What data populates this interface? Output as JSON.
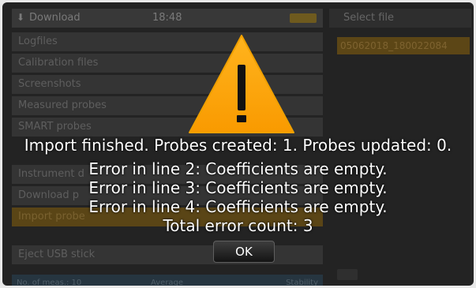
{
  "app": {
    "title": "Download",
    "time": "18:48",
    "badge": "",
    "menu": [
      {
        "label": "Logfiles"
      },
      {
        "label": "Calibration files"
      },
      {
        "label": "Screenshots"
      },
      {
        "label": "Measured probes"
      },
      {
        "label": "SMART probes"
      },
      {
        "label": "Instrument d"
      },
      {
        "label": "Download p"
      },
      {
        "label": "Import probe"
      },
      {
        "label": "Eject USB stick"
      }
    ],
    "status": {
      "left": "No. of meas.: 10",
      "mid": "Average",
      "right": "Stability"
    }
  },
  "file_panel": {
    "title": "Select file",
    "selected_file": "05062018_180022084"
  },
  "dialog": {
    "icon": "warning-icon",
    "icon_color": "#ffa500",
    "lines": [
      "Import finished. Probes created: 1. Probes updated: 0.",
      "Error in line 2: Coefficients are empty.",
      "Error in line 3: Coefficients are empty.",
      "Error in line 4: Coefficients are empty.",
      "Total error count: 3"
    ],
    "ok_label": "OK"
  }
}
